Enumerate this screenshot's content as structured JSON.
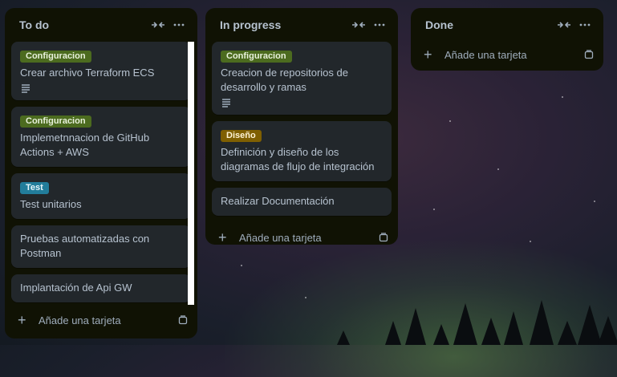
{
  "colors": {
    "list_bg": "#101204",
    "card_bg": "#22272b",
    "label_configuracion": "#4c6b1f",
    "label_test": "#227d9b",
    "label_diseno": "#7f5f01",
    "text": "#b6c2cf"
  },
  "lists": {
    "todo": {
      "title": "To do",
      "collapse_icon": "collapse-icon",
      "menu_icon": "more-icon",
      "add_card": "Añade una tarjeta",
      "cards": [
        {
          "label": "Configuracion",
          "title": "Crear archivo Terraform ECS",
          "has_description": true
        },
        {
          "label": "Configuracion",
          "title": "Implemetnnacion de GitHub Actions + AWS"
        },
        {
          "label": "Test",
          "title": "Test unitarios"
        },
        {
          "title": "Pruebas automatizadas con Postman"
        },
        {
          "title": "Implantación de Api GW"
        }
      ]
    },
    "inprogress": {
      "title": "In progress",
      "add_card": "Añade una tarjeta",
      "cards": [
        {
          "label": "Configuracion",
          "title": "Creacion de repositorios de desarrollo y ramas",
          "has_description": true
        },
        {
          "label": "Diseño",
          "title": "Definición y diseño de los diagramas de flujo de integración"
        },
        {
          "title": "Realizar Documentación"
        }
      ]
    },
    "done": {
      "title": "Done",
      "add_card": "Añade una tarjeta"
    }
  }
}
